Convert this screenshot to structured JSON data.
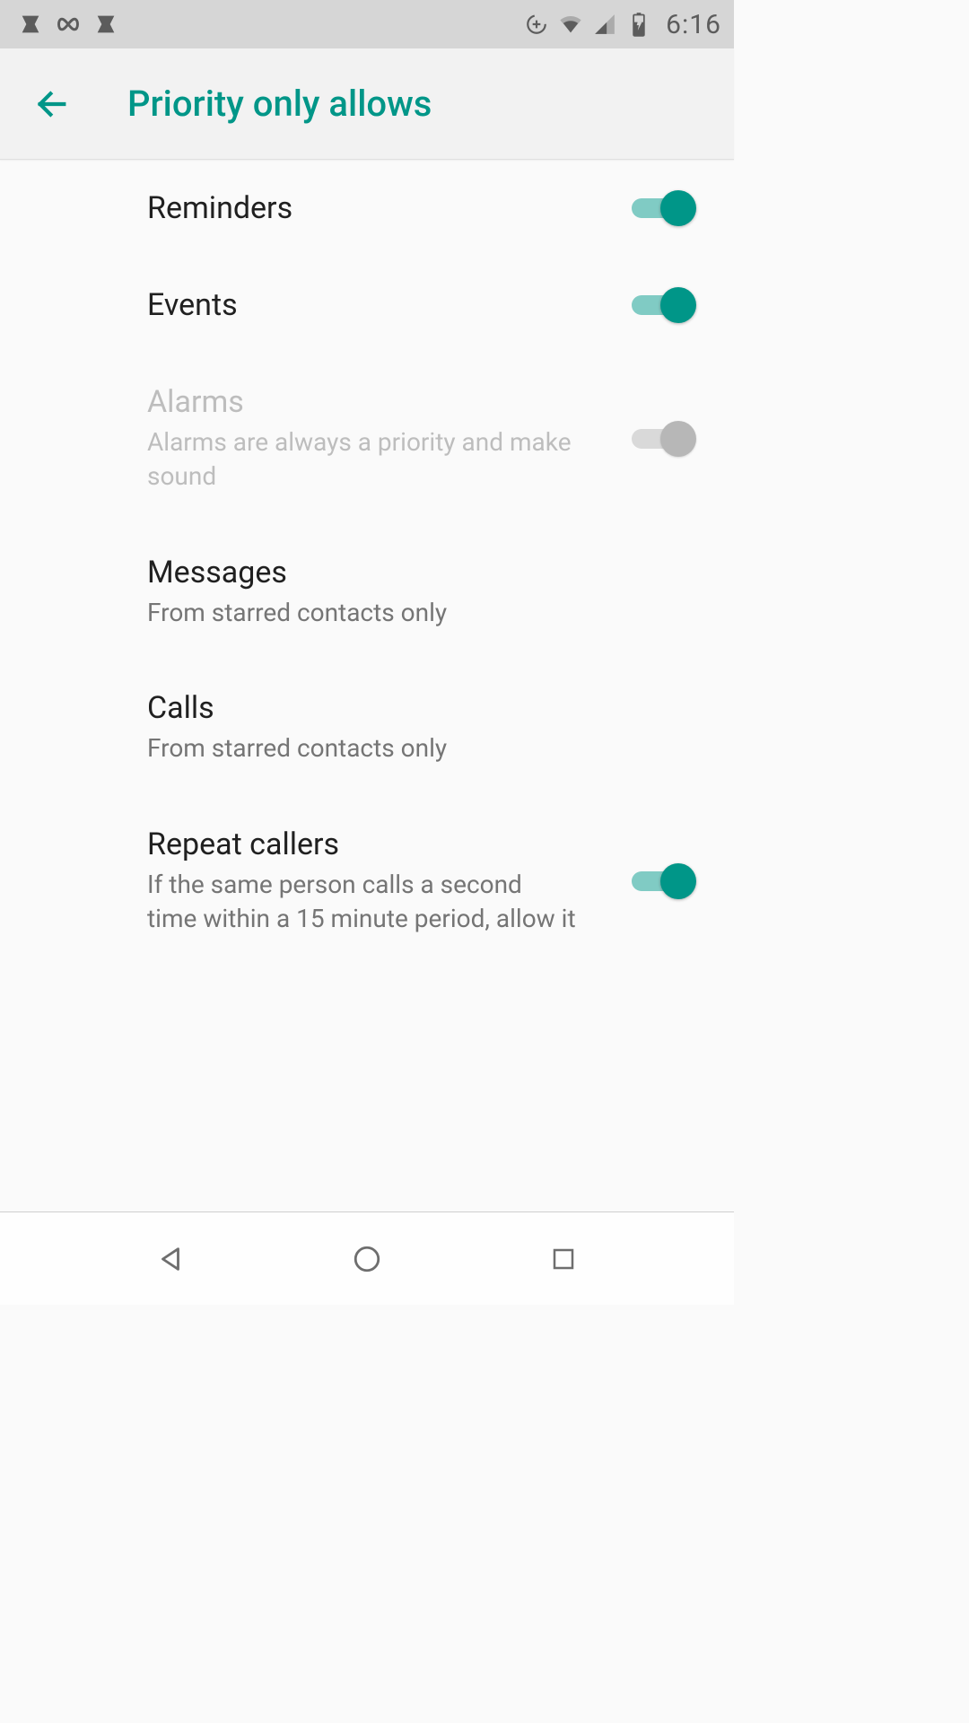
{
  "status": {
    "time": "6:16",
    "icons_left": [
      "app-notification-icon",
      "infinity-icon",
      "app-notification-icon"
    ],
    "icons_right": [
      "data-saver-icon",
      "wifi-icon",
      "cell-signal-icon",
      "battery-charging-icon"
    ]
  },
  "header": {
    "title": "Priority only allows"
  },
  "settings": [
    {
      "key": "reminders",
      "title": "Reminders",
      "subtitle": "",
      "toggle": "on",
      "disabled": false,
      "has_toggle": true
    },
    {
      "key": "events",
      "title": "Events",
      "subtitle": "",
      "toggle": "on",
      "disabled": false,
      "has_toggle": true
    },
    {
      "key": "alarms",
      "title": "Alarms",
      "subtitle": "Alarms are always a priority and make sound",
      "toggle": "disabled",
      "disabled": true,
      "has_toggle": true
    },
    {
      "key": "messages",
      "title": "Messages",
      "subtitle": "From starred contacts only",
      "toggle": "",
      "disabled": false,
      "has_toggle": false
    },
    {
      "key": "calls",
      "title": "Calls",
      "subtitle": "From starred contacts only",
      "toggle": "",
      "disabled": false,
      "has_toggle": false
    },
    {
      "key": "repeat-callers",
      "title": "Repeat callers",
      "subtitle": "If the same person calls a second time within a 15 minute period, allow it",
      "toggle": "on",
      "disabled": false,
      "has_toggle": true
    }
  ],
  "colors": {
    "accent": "#009688",
    "accent_light": "#80cbc4"
  }
}
